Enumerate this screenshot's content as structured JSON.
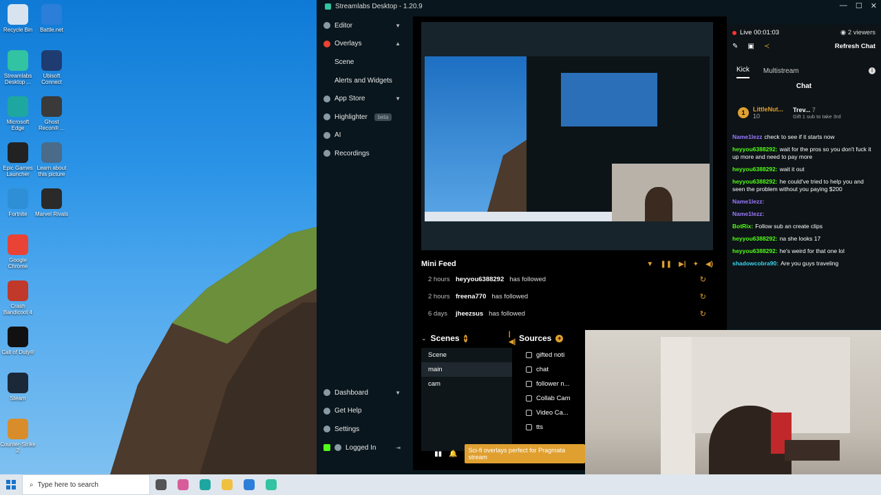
{
  "desktop": {
    "icons": [
      {
        "label": "Recycle Bin",
        "icon": "recycle-bin-icon",
        "color": "#d7e4f0"
      },
      {
        "label": "Battle.net",
        "icon": "battlenet-icon",
        "color": "#2b7fd8"
      },
      {
        "label": "Streamlabs Desktop ...",
        "icon": "streamlabs-icon",
        "color": "#31c3a2"
      },
      {
        "label": "Ubisoft Connect",
        "icon": "ubisoft-icon",
        "color": "#1e3c72"
      },
      {
        "label": "Microsoft Edge",
        "icon": "edge-icon",
        "color": "#1ea7a0"
      },
      {
        "label": "Ghost Recon® ...",
        "icon": "ghost-recon-icon",
        "color": "#3a3a3a"
      },
      {
        "label": "Epic Games Launcher",
        "icon": "epic-games-icon",
        "color": "#222222"
      },
      {
        "label": "Learn about this picture",
        "icon": "camera-icon",
        "color": "#4a6b8a"
      },
      {
        "label": "Fortnite",
        "icon": "fortnite-icon",
        "color": "#2e8fd6"
      },
      {
        "label": "Marvel Rivals",
        "icon": "marvel-rivals-icon",
        "color": "#2a2a2a"
      },
      {
        "label": "Google Chrome",
        "icon": "chrome-icon",
        "color": "#e84335"
      },
      {
        "label": "Crash Bandicoot 4",
        "icon": "crash-icon",
        "color": "#c0392b"
      },
      {
        "label": "Call of Duty®",
        "icon": "cod-icon",
        "color": "#111111"
      },
      {
        "label": "Steam",
        "icon": "steam-icon",
        "color": "#1b2838"
      },
      {
        "label": "Counter-Strike 2",
        "icon": "cs2-icon",
        "color": "#d88d2a"
      }
    ]
  },
  "taskbar": {
    "search_placeholder": "Type here to search",
    "apps": [
      {
        "icon": "task-view-icon",
        "color": "#555555"
      },
      {
        "icon": "copilot-icon",
        "color": "#d85c9a"
      },
      {
        "icon": "edge-icon",
        "color": "#1ea7a0"
      },
      {
        "icon": "file-explorer-icon",
        "color": "#f0c040"
      },
      {
        "icon": "mail-icon",
        "color": "#2b7fd8"
      },
      {
        "icon": "streamlabs-icon",
        "color": "#31c3a2"
      }
    ]
  },
  "streamlabs": {
    "title": "Streamlabs Desktop - 1.20.9",
    "nav": {
      "editor": "Editor",
      "overlays": "Overlays",
      "scene": "Scene",
      "alerts": "Alerts and Widgets",
      "app_store": "App Store",
      "highlighter": "Highlighter",
      "beta": "beta",
      "ai": "AI",
      "recordings": "Recordings",
      "dashboard": "Dashboard",
      "get_help": "Get Help",
      "settings": "Settings",
      "logged_in": "Logged In"
    },
    "mini_feed": {
      "title": "Mini Feed",
      "rows": [
        {
          "time": "2 hours",
          "user": "heyyou6388292",
          "action": "has followed"
        },
        {
          "time": "2 hours",
          "user": "freena770",
          "action": "has followed"
        },
        {
          "time": "6 days",
          "user": "jheezsus",
          "action": "has followed"
        }
      ]
    },
    "scenes": {
      "title": "Scenes",
      "items": [
        "Scene",
        "main",
        "cam"
      ],
      "selected": "main"
    },
    "sources": {
      "title": "Sources",
      "items": [
        "gifted noti",
        "chat",
        "follower n...",
        "Collab Cam",
        "Video Ca...",
        "tts"
      ]
    },
    "promo": "Sci-fi overlays perfect for Pragmata stream",
    "chat": {
      "live_label": "Live 00:01:03",
      "viewers": "2 viewers",
      "refresh": "Refresh Chat",
      "tabs": [
        "Kick",
        "Multistream"
      ],
      "title": "Chat",
      "gift": {
        "name": "LittleNut...",
        "count": "10",
        "badge": "1",
        "gifter": "Trev...",
        "gift_count": "7",
        "note": "Gift 1 sub to take 3rd"
      },
      "messages": [
        {
          "user": "Name1lezz",
          "color": "u-purple",
          "text": "check to see if it starts now"
        },
        {
          "user": "heyyou6388292:",
          "color": "u-green",
          "text": "wait for the pros so you don't fuck it up more and need to pay more"
        },
        {
          "user": "heyyou6388292:",
          "color": "u-green",
          "text": "wait it out"
        },
        {
          "user": "heyyou6388292:",
          "color": "u-green",
          "text": "he could've tried to help you and seen the problem without you paying $200"
        },
        {
          "user": "Name1lezz:",
          "color": "u-purple",
          "text": ""
        },
        {
          "user": "Name1lezz:",
          "color": "u-purple",
          "text": ""
        },
        {
          "user": "BotRix:",
          "color": "u-green",
          "text": "Follow sub an create clips"
        },
        {
          "user": "heyyou6388292:",
          "color": "u-green",
          "text": "na she looks 17"
        },
        {
          "user": "heyyou6388292:",
          "color": "u-green",
          "text": "he's weird for that one lol"
        },
        {
          "user": "shadowcobra90:",
          "color": "u-cyan",
          "text": "Are you guys traveling"
        }
      ]
    }
  }
}
